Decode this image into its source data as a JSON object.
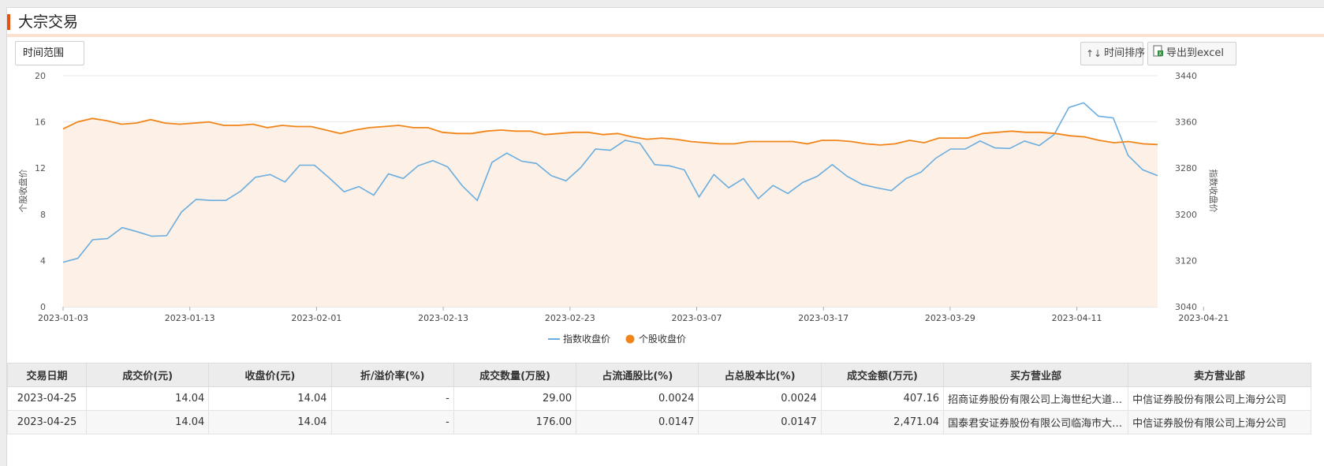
{
  "header": {
    "title": "大宗交易"
  },
  "toolbar": {
    "range_label": "时间范围",
    "sort_label": "时间排序",
    "export_label": "导出到excel"
  },
  "icons": {
    "sort": "sort-up-down-icon",
    "export": "excel-export-icon"
  },
  "colors": {
    "accent": "#e8520f",
    "index_line": "#6aaddf",
    "stock_line": "#f08519",
    "area_fill": "#fdf0e6"
  },
  "chart_data": {
    "type": "line",
    "left_axis_label": "个股收盘价",
    "right_axis_label": "指数收盘价",
    "left_ticks": [
      "20",
      "16",
      "12",
      "8",
      "4",
      "0"
    ],
    "right_ticks": [
      "3440",
      "3360",
      "3280",
      "3200",
      "3120",
      "3040"
    ],
    "ylim_left": [
      0,
      20
    ],
    "ylim_right": [
      3040,
      3440
    ],
    "x_tick_labels": [
      "2023-01-03",
      "2023-01-13",
      "2023-02-01",
      "2023-02-13",
      "2023-02-23",
      "2023-03-07",
      "2023-03-17",
      "2023-03-29",
      "2023-04-11",
      "2023-04-21"
    ],
    "legend": [
      "指数收盘价",
      "个股收盘价"
    ],
    "legend_position": "bottom",
    "grid": true,
    "series": [
      {
        "name": "指数收盘价",
        "axis": "right",
        "values": [
          3117,
          3124,
          3156,
          3158,
          3177,
          3170,
          3162,
          3163,
          3204,
          3226,
          3224,
          3224,
          3240,
          3264,
          3269,
          3256,
          3285,
          3285,
          3263,
          3239,
          3248,
          3233,
          3270,
          3262,
          3284,
          3293,
          3282,
          3249,
          3224,
          3290,
          3306,
          3292,
          3288,
          3267,
          3258,
          3281,
          3313,
          3311,
          3328,
          3323,
          3286,
          3284,
          3277,
          3230,
          3269,
          3246,
          3262,
          3227,
          3250,
          3236,
          3255,
          3266,
          3286,
          3266,
          3252,
          3246,
          3241,
          3262,
          3273,
          3297,
          3313,
          3313,
          3327,
          3315,
          3314,
          3327,
          3319,
          3338,
          3385,
          3393,
          3370,
          3367,
          3302,
          3277,
          3267
        ]
      },
      {
        "name": "个股收盘价",
        "axis": "left",
        "values": [
          15.4,
          16.0,
          16.3,
          16.1,
          15.8,
          15.9,
          16.2,
          15.9,
          15.8,
          15.9,
          16.0,
          15.7,
          15.7,
          15.8,
          15.5,
          15.7,
          15.6,
          15.6,
          15.3,
          15.0,
          15.3,
          15.5,
          15.6,
          15.7,
          15.5,
          15.5,
          15.1,
          15.0,
          15.0,
          15.2,
          15.3,
          15.2,
          15.2,
          14.9,
          15.0,
          15.1,
          15.1,
          14.9,
          15.0,
          14.7,
          14.5,
          14.6,
          14.5,
          14.3,
          14.2,
          14.1,
          14.1,
          14.3,
          14.3,
          14.3,
          14.3,
          14.1,
          14.4,
          14.4,
          14.3,
          14.1,
          14.0,
          14.1,
          14.4,
          14.2,
          14.6,
          14.6,
          14.6,
          15.0,
          15.1,
          15.2,
          15.1,
          15.1,
          15.0,
          14.8,
          14.7,
          14.4,
          14.2,
          14.3,
          14.1,
          14.04
        ]
      }
    ]
  },
  "table": {
    "columns": [
      "交易日期",
      "成交价(元)",
      "收盘价(元)",
      "折/溢价率(%)",
      "成交数量(万股)",
      "占流通股比(%)",
      "占总股本比(%)",
      "成交金额(万元)",
      "买方营业部",
      "卖方营业部"
    ],
    "rows": [
      [
        "2023-04-25",
        "14.04",
        "14.04",
        "-",
        "29.00",
        "0.0024",
        "0.0024",
        "407.16",
        "招商证券股份有限公司上海世纪大道证券营业部",
        "中信证券股份有限公司上海分公司"
      ],
      [
        "2023-04-25",
        "14.04",
        "14.04",
        "-",
        "176.00",
        "0.0147",
        "0.0147",
        "2,471.04",
        "国泰君安证券股份有限公司临海市大洋证券营业部",
        "中信证券股份有限公司上海分公司"
      ]
    ]
  }
}
